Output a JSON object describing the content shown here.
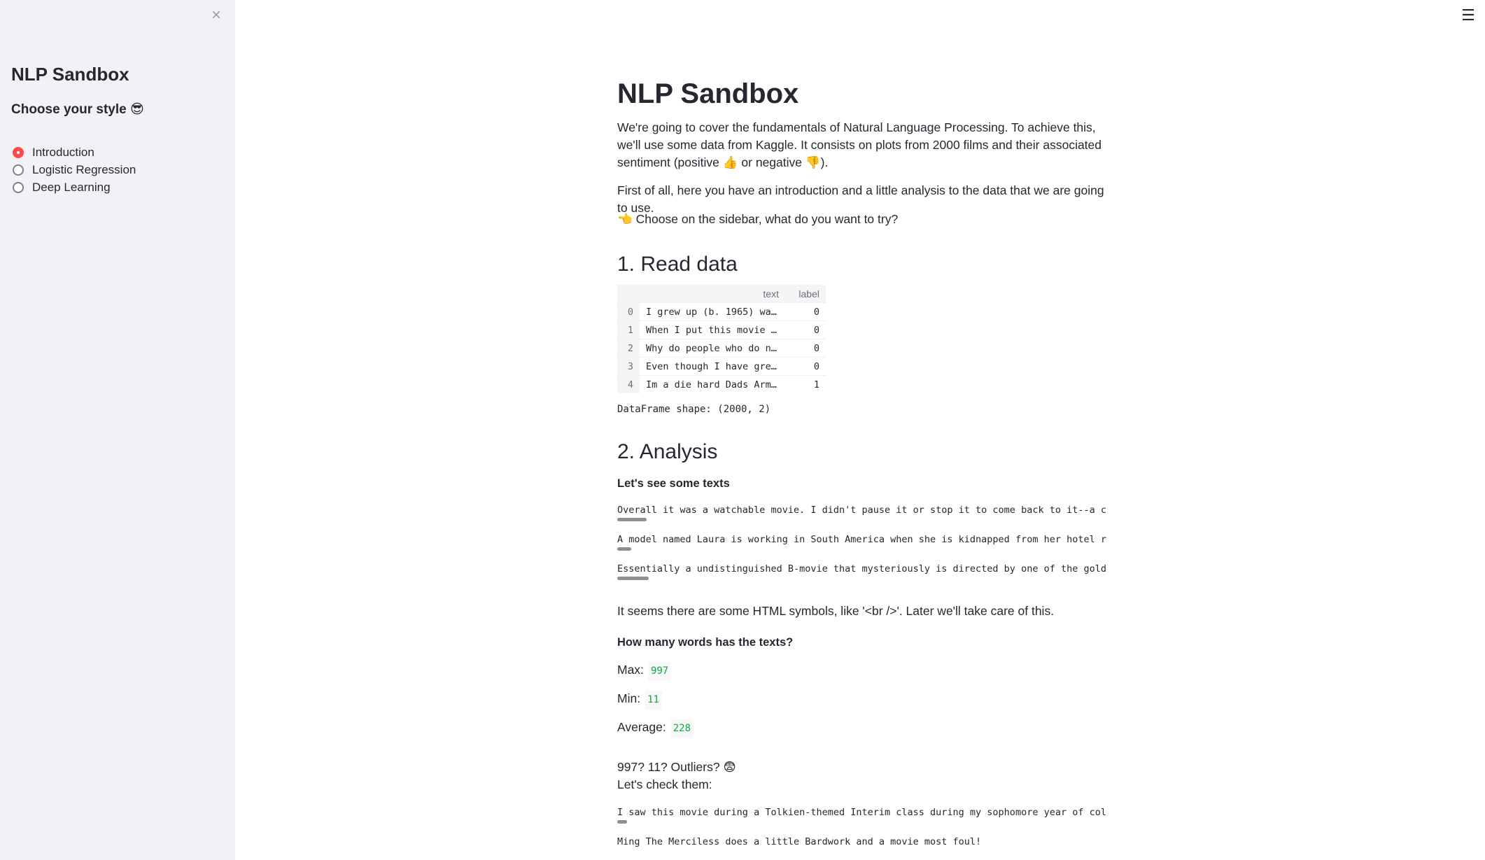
{
  "sidebar": {
    "close_icon": "×",
    "title": "NLP Sandbox",
    "subtitle": "Choose your style 😎",
    "options": [
      {
        "label": "Introduction",
        "selected": true
      },
      {
        "label": "Logistic Regression",
        "selected": false
      },
      {
        "label": "Deep Learning",
        "selected": false
      }
    ]
  },
  "menu_icon": "☰",
  "main": {
    "title": "NLP Sandbox",
    "intro": "We're going to cover the fundamentals of Natural Language Processing. To achieve this, we'll use some data from Kaggle. It consists on plots from 2000 films and their associated sentiment (positive 👍 or negative 👎).",
    "intro2": "First of all, here you have an introduction and a little analysis to the data that we are going to use.",
    "intro3": "👈 Choose on the sidebar, what do you want to try?",
    "section1": "1. Read data",
    "table": {
      "headers": [
        "text",
        "label"
      ],
      "rows": [
        {
          "idx": "0",
          "text": "I grew up (b. 1965) wa…",
          "label": "0"
        },
        {
          "idx": "1",
          "text": "When I put this movie …",
          "label": "0"
        },
        {
          "idx": "2",
          "text": "Why do people who do n…",
          "label": "0"
        },
        {
          "idx": "3",
          "text": "Even though I have gre…",
          "label": "0"
        },
        {
          "idx": "4",
          "text": "Im a die hard Dads Arm…",
          "label": "1"
        }
      ]
    },
    "shape": "DataFrame shape: (2000, 2)",
    "section2": "2. Analysis",
    "sub_texts": "Let's see some texts",
    "samples": [
      "Overall it was a watchable movie. I didn't pause it or stop it to come back to it--a clear",
      "A model named Laura is working in South America when she is kidnapped from her hotel room b",
      "Essentially a undistinguished B-movie that mysteriously is directed by one of the golden er"
    ],
    "html_note": "It seems there are some HTML symbols, like '<br />'. Later we'll take care of this.",
    "sub_words": "How many words has the texts?",
    "stats": {
      "max_label": "Max:",
      "max": "997",
      "min_label": "Min:",
      "min": "11",
      "avg_label": "Average:",
      "avg": "228"
    },
    "outliers_line1": "997? 11? Outliers? 😨",
    "outliers_line2": "Let's check them:",
    "outlier_samples": [
      "I saw this movie during a Tolkien-themed Interim class during my sophomore year of college.",
      "Ming The Merciless does a little Bardwork and a movie most foul!"
    ]
  }
}
